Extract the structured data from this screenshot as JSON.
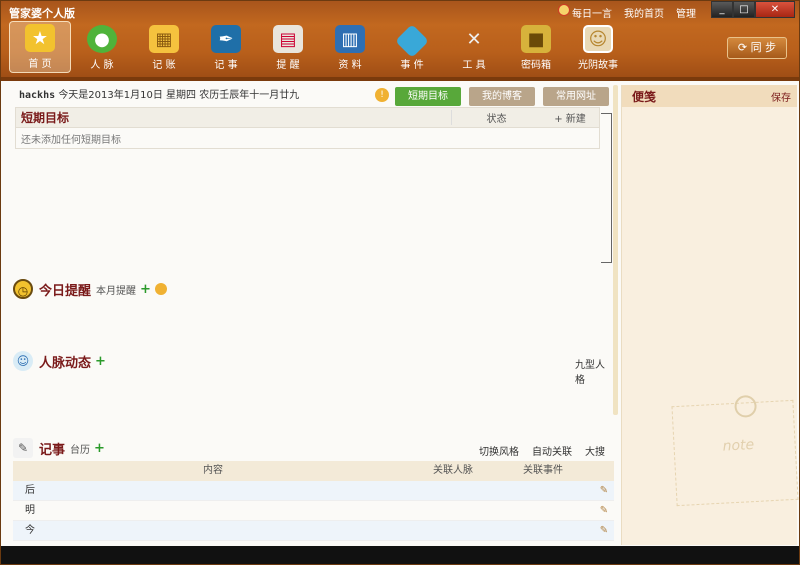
{
  "window": {
    "title": "管家婆个人版"
  },
  "topmenu": {
    "daily": "每日一言",
    "home": "我的首页",
    "manage": "管理"
  },
  "toolbar": [
    {
      "name": "home",
      "label": "首 页",
      "icon": "star",
      "color": "#f2c22e"
    },
    {
      "name": "contacts",
      "label": "人 脉",
      "icon": "person",
      "color": "#4fb33a"
    },
    {
      "name": "accounts",
      "label": "记 账",
      "icon": "ledger",
      "color": "#f5c23e"
    },
    {
      "name": "notes",
      "label": "记 事",
      "icon": "ink",
      "color": "#1f6fa8"
    },
    {
      "name": "remind",
      "label": "提 醒",
      "icon": "calendar",
      "color": "#e9e5dc"
    },
    {
      "name": "data",
      "label": "资 料",
      "icon": "book",
      "color": "#2e6fb3"
    },
    {
      "name": "event",
      "label": "事 件",
      "icon": "diamond",
      "color": "#39a8d8"
    },
    {
      "name": "tools",
      "label": "工 具",
      "icon": "wrench",
      "color": "#c8c8c8"
    },
    {
      "name": "vault",
      "label": "密码箱",
      "icon": "lock",
      "color": "#d7b23b"
    },
    {
      "name": "story",
      "label": "光阴故事",
      "icon": "photo",
      "color": "#e9d9b6"
    }
  ],
  "sync_label": "同 步",
  "infobar": {
    "user": "hackhs",
    "date_text": "今天是2013年1月10日  星期四  农历壬辰年十一月廿九"
  },
  "tabs": [
    {
      "label": "短期目标",
      "active": true
    },
    {
      "label": "我的博客",
      "active": false
    },
    {
      "label": "常用网址",
      "active": false
    }
  ],
  "goals": {
    "title": "短期目标",
    "status_header": "状态",
    "new_label": "+ 新建",
    "empty_text": "还未添加任何短期目标"
  },
  "today_remind": {
    "title": "今日提醒",
    "sub": "本月提醒"
  },
  "contacts_news": {
    "title": "人脉动态",
    "link": "九型人格"
  },
  "notes_section": {
    "title": "记事",
    "sub": "台历",
    "links": [
      "切换风格",
      "自动关联",
      "大搜索"
    ],
    "columns": [
      "内容",
      "关联人脉",
      "关联事件"
    ],
    "rows": [
      "后",
      "明",
      "今"
    ]
  },
  "sidebar": {
    "title": "便笺",
    "save": "保存",
    "note_label": "note"
  }
}
